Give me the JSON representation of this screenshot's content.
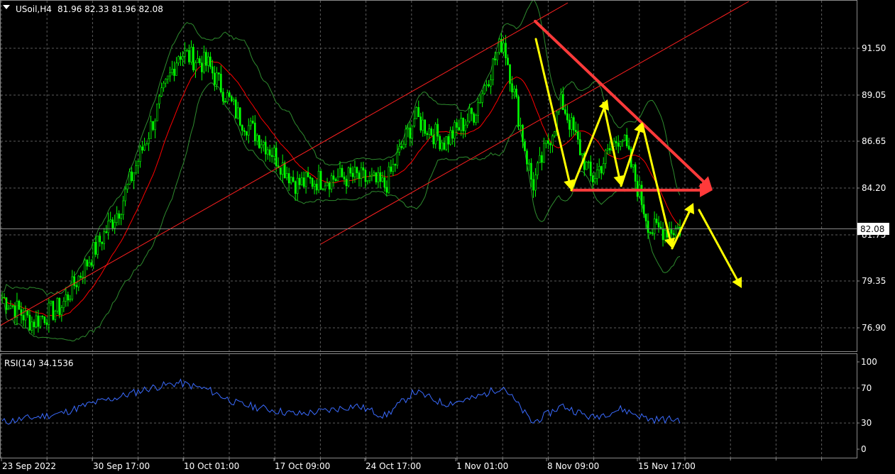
{
  "header": {
    "symbol": "USoil,H4",
    "ohlc": "81.96 82.33 81.96 82.08"
  },
  "price_axis": {
    "labels": [
      "91.50",
      "89.05",
      "86.65",
      "84.20",
      "81.75",
      "79.35",
      "76.90"
    ],
    "current_price": "82.08"
  },
  "rsi": {
    "title": "RSI(14) 34.1536",
    "labels": [
      "100",
      "70",
      "30",
      "0"
    ]
  },
  "time_axis": {
    "labels": [
      "23 Sep 2022",
      "30 Sep 17:00",
      "10 Oct 01:00",
      "17 Oct 09:00",
      "24 Oct 17:00",
      "1 Nov 01:00",
      "8 Nov 09:00",
      "15 Nov 17:00"
    ]
  },
  "colors": {
    "background": "#000000",
    "grid": "#5c5c5c",
    "candles": "#00ff00",
    "bands": "#2e8b2e",
    "ma": "#ff0000",
    "rsi_line": "#3a6bff",
    "channel": "#ff2020",
    "arrow_yellow": "#ffff00",
    "arrow_red": "#ff3a3a"
  },
  "chart_data": {
    "type": "candlestick",
    "symbol": "USoil",
    "timeframe": "H4",
    "y_range": [
      75.9,
      94.3
    ],
    "close_series": [
      {
        "x": "23 Sep 2022",
        "y": 78.5
      },
      {
        "x": "26 Sep",
        "y": 77.2
      },
      {
        "x": "28 Sep",
        "y": 78.0
      },
      {
        "x": "30 Sep 17:00",
        "y": 80.6
      },
      {
        "x": "3 Oct",
        "y": 83.2
      },
      {
        "x": "5 Oct",
        "y": 87.2
      },
      {
        "x": "7 Oct",
        "y": 91.3
      },
      {
        "x": "10 Oct 01:00",
        "y": 90.6
      },
      {
        "x": "12 Oct",
        "y": 88.0
      },
      {
        "x": "14 Oct",
        "y": 86.4
      },
      {
        "x": "17 Oct 09:00",
        "y": 84.4
      },
      {
        "x": "19 Oct",
        "y": 84.7
      },
      {
        "x": "21 Oct",
        "y": 84.8
      },
      {
        "x": "24 Oct 17:00",
        "y": 84.3
      },
      {
        "x": "27 Oct",
        "y": 87.9
      },
      {
        "x": "31 Oct",
        "y": 86.6
      },
      {
        "x": "1 Nov 01:00",
        "y": 88.1
      },
      {
        "x": "4 Nov",
        "y": 92.0
      },
      {
        "x": "8 Nov 09:00",
        "y": 84.3
      },
      {
        "x": "10 Nov",
        "y": 88.7
      },
      {
        "x": "11 Nov",
        "y": 84.6
      },
      {
        "x": "14 Nov",
        "y": 87.1
      },
      {
        "x": "15 Nov 17:00",
        "y": 82.0
      },
      {
        "x": "16 Nov",
        "y": 82.08
      }
    ],
    "rsi_series": [
      31,
      36,
      41,
      52,
      60,
      70,
      76,
      68,
      52,
      46,
      40,
      44,
      50,
      38,
      66,
      52,
      58,
      72,
      30,
      50,
      36,
      46,
      34,
      34.15
    ],
    "annotations": {
      "channel": "ascending",
      "triangle": "descending",
      "support_level": 84.2
    }
  }
}
